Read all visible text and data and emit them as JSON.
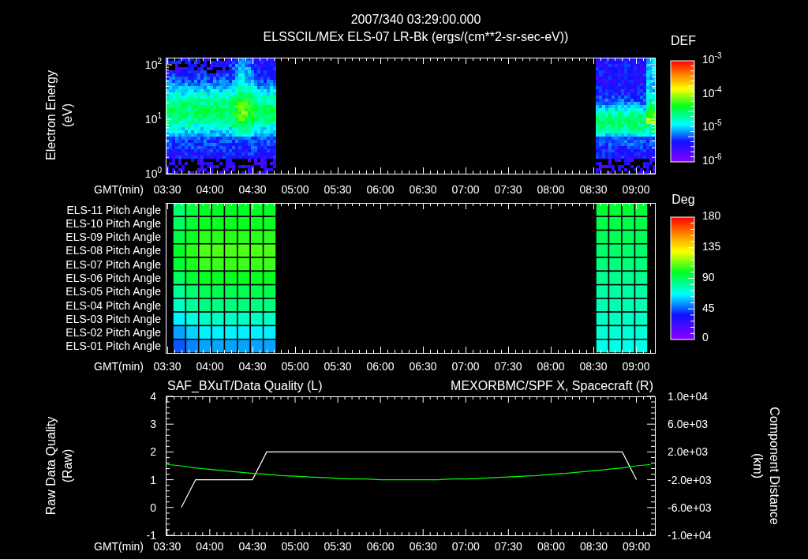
{
  "header": {
    "title": "2007/340 03:29:00.000",
    "subtitle": "ELSSCIL/MEx ELS-07 LR-Bk  (ergs/(cm**2-sr-sec-eV))"
  },
  "energy_panel": {
    "ylabel": "Electron Energy\n(eV)",
    "yticks": [
      "10$^{2}$",
      "10$^{1}$",
      "10$^{0}$"
    ],
    "xaxis_label": "GMT(min)",
    "xticks": [
      "03:30",
      "04:00",
      "04:30",
      "05:00",
      "05:30",
      "06:00",
      "06:30",
      "07:00",
      "07:30",
      "08:00",
      "08:30",
      "09:00"
    ],
    "colorbar": {
      "title": "DEF",
      "ticks": [
        "10$^{-3}$",
        "10$^{-4}$",
        "10$^{-5}$",
        "10$^{-6}$"
      ]
    }
  },
  "pitch_panel": {
    "rows": [
      "ELS-11 Pitch Angle",
      "ELS-10 Pitch Angle",
      "ELS-09 Pitch Angle",
      "ELS-08 Pitch Angle",
      "ELS-07 Pitch Angle",
      "ELS-06 Pitch Angle",
      "ELS-05 Pitch Angle",
      "ELS-04 Pitch Angle",
      "ELS-03 Pitch Angle",
      "ELS-02 Pitch Angle",
      "ELS-01 Pitch Angle"
    ],
    "xaxis_label": "GMT(min)",
    "xticks": [
      "03:30",
      "04:00",
      "04:30",
      "05:00",
      "05:30",
      "06:00",
      "06:30",
      "07:00",
      "07:30",
      "08:00",
      "08:30",
      "09:00"
    ],
    "colorbar": {
      "title": "Deg",
      "ticks": [
        "180",
        "135",
        "90",
        "45",
        "0"
      ]
    }
  },
  "quality_panel": {
    "xaxis_label": "GMT(min)",
    "chart_data": {
      "type": "line",
      "ylabel": "Raw Data Quality\n(Raw)",
      "y2label": "Component Distance\n(km)",
      "y2lim": [
        -10000,
        10000
      ],
      "y2ticks": [
        {
          "value": 10000,
          "label": "1.0e+04"
        },
        {
          "value": 6000,
          "label": "6.0e+03"
        },
        {
          "value": 2000,
          "label": "2.0e+03"
        },
        {
          "value": -2000,
          "label": "-2.0e+03"
        },
        {
          "value": -6000,
          "label": "-6.0e+03"
        },
        {
          "value": -10000,
          "label": "-1.0e+04"
        }
      ],
      "x": [
        210,
        220,
        230,
        240,
        250,
        260,
        270,
        280,
        290,
        300,
        310,
        320,
        330,
        340,
        350,
        360,
        370,
        380,
        390,
        400,
        410,
        420,
        430,
        440,
        450,
        460,
        470,
        480,
        490,
        500,
        510,
        520,
        530,
        540,
        550
      ],
      "xlim": [
        209,
        553
      ],
      "ylim": [
        -1,
        4
      ],
      "xticks": [
        {
          "value": 210,
          "label": "03:30"
        },
        {
          "value": 240,
          "label": "04:00"
        },
        {
          "value": 270,
          "label": "04:30"
        },
        {
          "value": 300,
          "label": "05:00"
        },
        {
          "value": 330,
          "label": "05:30"
        },
        {
          "value": 360,
          "label": "06:00"
        },
        {
          "value": 390,
          "label": "06:30"
        },
        {
          "value": 420,
          "label": "07:00"
        },
        {
          "value": 450,
          "label": "07:30"
        },
        {
          "value": 480,
          "label": "08:00"
        },
        {
          "value": 510,
          "label": "08:30"
        },
        {
          "value": 540,
          "label": "09:00"
        }
      ],
      "yticks": [
        -1,
        0,
        1,
        2,
        3,
        4
      ],
      "series": [
        {
          "name": "SAF_BXuT/Data Quality (L)",
          "color": "#ffffff",
          "values": [
            null,
            0,
            1,
            1,
            1,
            1,
            1,
            2,
            2,
            2,
            2,
            2,
            2,
            2,
            2,
            2,
            2,
            2,
            2,
            2,
            2,
            2,
            2,
            2,
            2,
            2,
            2,
            2,
            2,
            2,
            2,
            2,
            2,
            1,
            null
          ]
        },
        {
          "name": "MEXORBMC/SPF X, Spacecraft (R)",
          "color": "#00ff00",
          "axis": "y2",
          "values": [
            200,
            0,
            -300,
            -500,
            -700,
            -900,
            -1100,
            -1200,
            -1400,
            -1500,
            -1600,
            -1700,
            -1800,
            -1900,
            -1900,
            -2000,
            -2000,
            -2000,
            -2000,
            -2000,
            -1900,
            -1900,
            -1800,
            -1700,
            -1600,
            -1500,
            -1400,
            -1200,
            -1100,
            -900,
            -700,
            -500,
            -300,
            0,
            200
          ]
        }
      ]
    }
  }
}
